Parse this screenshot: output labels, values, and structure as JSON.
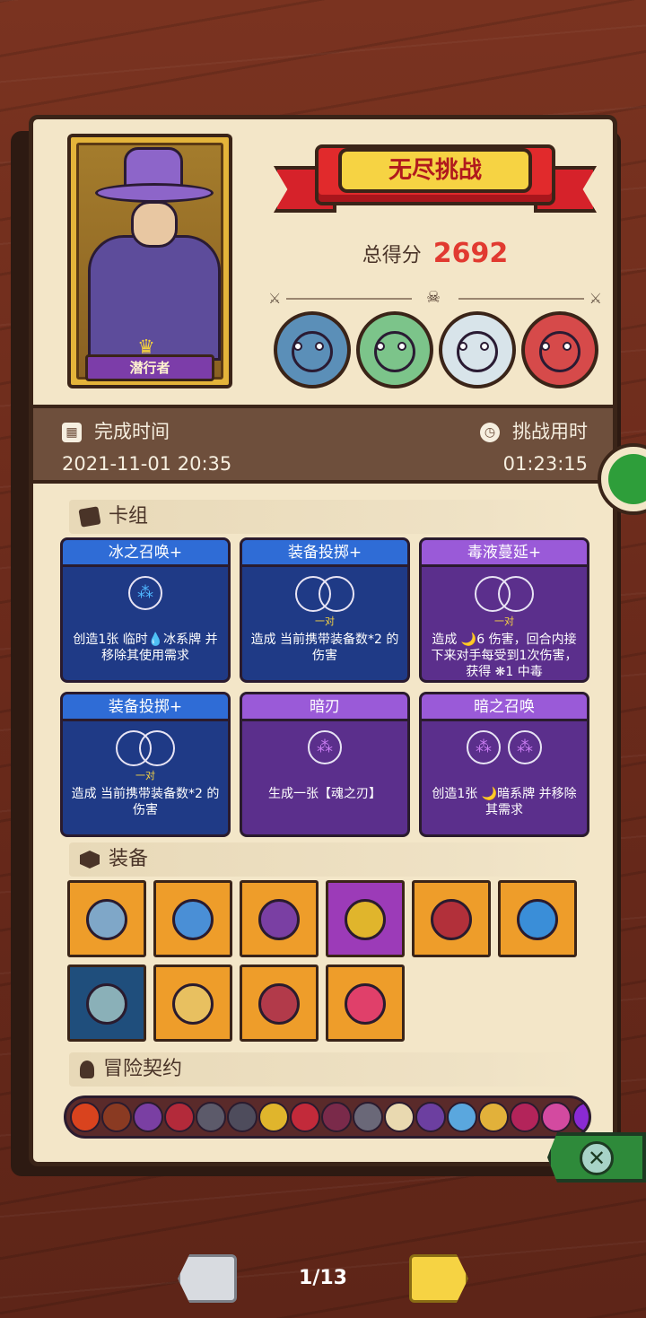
{
  "banner": {
    "title": "无尽挑战"
  },
  "score": {
    "label": "总得分",
    "value": "2692"
  },
  "hero": {
    "name": "潜行者"
  },
  "time": {
    "finish_label": "完成时间",
    "finish_value": "2021-11-01 20:35",
    "duration_label": "挑战用时",
    "duration_value": "01:23:15"
  },
  "sections": {
    "deck": "卡组",
    "equipment": "装备",
    "contracts": "冒险契约"
  },
  "cards": [
    {
      "title": "冰之召唤+",
      "color": "blue",
      "icon": "ice-orb-icon",
      "sub": "",
      "desc": "创造1张 临时💧冰系牌 并移除其使用需求"
    },
    {
      "title": "装备投掷+",
      "color": "blue",
      "icon": "pair-icon",
      "sub": "一对",
      "desc": "造成 当前携带装备数*2 的伤害"
    },
    {
      "title": "毒液蔓延+",
      "color": "purple",
      "icon": "pair-icon",
      "sub": "一对",
      "desc": "造成 🌙6 伤害，回合内接下来对手每受到1次伤害，获得 ❋1 中毒"
    },
    {
      "title": "装备投掷+",
      "color": "blue",
      "icon": "pair-icon",
      "sub": "一对",
      "desc": "造成 当前携带装备数*2 的伤害"
    },
    {
      "title": "暗刃",
      "color": "purple",
      "icon": "grape-orb-icon",
      "sub": "",
      "desc": "生成一张【魂之刃】"
    },
    {
      "title": "暗之召唤",
      "color": "purple",
      "icon": "double-grape-orb-icon",
      "sub": "",
      "desc": "创造1张 🌙暗系牌 并移除其需求"
    }
  ],
  "equipment": [
    {
      "name": "horn-item-icon",
      "bg": "orange"
    },
    {
      "name": "blue-mushroom-item-icon",
      "bg": "orange"
    },
    {
      "name": "eye-flask-item-icon",
      "bg": "orange"
    },
    {
      "name": "gem-amulet-item-icon",
      "bg": "purple"
    },
    {
      "name": "spiked-collar-item-icon",
      "bg": "orange"
    },
    {
      "name": "blue-orb-ring-item-icon",
      "bg": "orange"
    },
    {
      "name": "axe-blade-item-icon",
      "bg": "navy"
    },
    {
      "name": "money-bag-item-icon",
      "bg": "orange"
    },
    {
      "name": "cursed-heart-item-icon",
      "bg": "orange"
    },
    {
      "name": "fire-orb-item-icon",
      "bg": "orange"
    }
  ],
  "contracts": [
    {
      "name": "flame-contract-icon",
      "color": "#d9431e"
    },
    {
      "name": "box-contract-icon",
      "color": "#8a3a22"
    },
    {
      "name": "shield-contract-icon",
      "color": "#7a3fa3"
    },
    {
      "name": "jaw-contract-icon",
      "color": "#b32a3a"
    },
    {
      "name": "tombstone-contract-icon",
      "color": "#5c5a6a"
    },
    {
      "name": "dark-stone-contract-icon",
      "color": "#4e4c5c"
    },
    {
      "name": "coin-contract-icon",
      "color": "#e0b52c"
    },
    {
      "name": "demon-contract-icon",
      "color": "#c22a3a"
    },
    {
      "name": "rune-contract-icon",
      "color": "#7a2a4a"
    },
    {
      "name": "slab-contract-icon",
      "color": "#6a6878"
    },
    {
      "name": "bone-contract-icon",
      "color": "#e9d9b0"
    },
    {
      "name": "skull-contract-icon",
      "color": "#6c3fa0"
    },
    {
      "name": "ice-contract-icon",
      "color": "#5aa7de"
    },
    {
      "name": "scroll-contract-icon",
      "color": "#e2b13a"
    },
    {
      "name": "heart-lock-contract-icon",
      "color": "#b3245a"
    },
    {
      "name": "pink-beast-contract-icon",
      "color": "#d34aa0"
    },
    {
      "name": "purple-mask-contract-icon",
      "color": "#8a2ad4"
    }
  ],
  "bosses": [
    {
      "name": "blue-ogre-boss-avatar",
      "color": "#5b8fb8"
    },
    {
      "name": "green-dragon-boss-avatar",
      "color": "#7cc48a"
    },
    {
      "name": "yeti-kid-boss-avatar",
      "color": "#d8e4ea"
    },
    {
      "name": "vampire-boss-avatar",
      "color": "#d64a4a"
    }
  ],
  "pager": {
    "text": "1/13"
  }
}
